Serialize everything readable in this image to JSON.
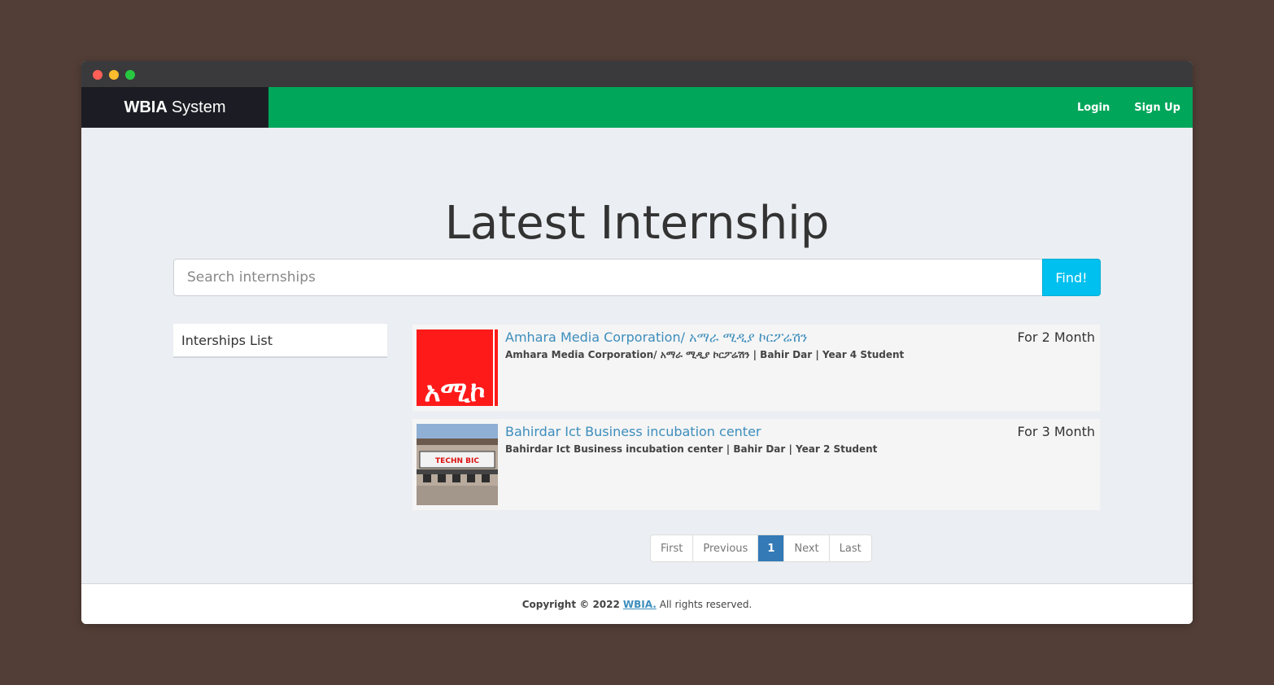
{
  "app": {
    "brand_bold": "WBIA",
    "brand_rest": "System"
  },
  "nav": {
    "login": "Login",
    "signup": "Sign Up"
  },
  "page": {
    "title": "Latest Internship"
  },
  "search": {
    "placeholder": "Search internships",
    "button": "Find!"
  },
  "sidebar": {
    "title": "Interships List"
  },
  "listings": [
    {
      "title": "Amhara Media Corporation/ አማራ ሚዲያ ኮርፖሬሽን",
      "meta": "Amhara Media Corporation/ አማራ ሚዲያ ኮርፖሬሽን | Bahir Dar | Year 4 Student",
      "duration": "For 2 Month",
      "logo_text": "አሚኮ"
    },
    {
      "title": "Bahirdar Ict Business incubation center",
      "meta": "Bahirdar Ict Business incubation center | Bahir Dar | Year 2 Student",
      "duration": "For 3 Month",
      "logo_text": "TECHN  BIC"
    }
  ],
  "pagination": {
    "first": "First",
    "previous": "Previous",
    "current": "1",
    "next": "Next",
    "last": "Last"
  },
  "footer": {
    "copyright": "Copyright © 2022",
    "brand": "WBIA.",
    "rest": "All rights reserved."
  },
  "colors": {
    "navbar": "#00a65a",
    "brand_bg": "#1c1d24",
    "find_button": "#00c0ef",
    "link": "#3c8dbc",
    "active_page": "#337ab7"
  }
}
